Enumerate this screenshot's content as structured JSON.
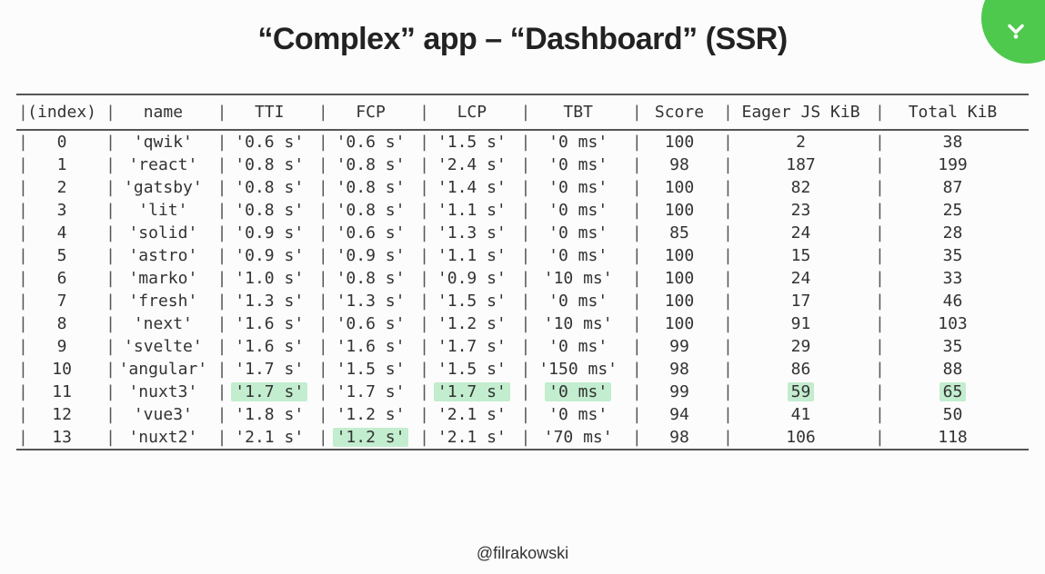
{
  "title": "“Complex” app – “Dashboard” (SSR)",
  "footer": "@filrakowski",
  "badge_icon": "chevron-down-icon",
  "columns": [
    "(index)",
    "name",
    "TTI",
    "FCP",
    "LCP",
    "TBT",
    "Score",
    "Eager JS KiB",
    "Total KiB"
  ],
  "highlight_color": "#c3edcf",
  "rows": [
    {
      "index": "0",
      "name": "'qwik'",
      "tti": "'0.6 s'",
      "fcp": "'0.6 s'",
      "lcp": "'1.5 s'",
      "tbt": "'0 ms'",
      "score": "100",
      "eager": "2",
      "total": "38"
    },
    {
      "index": "1",
      "name": "'react'",
      "tti": "'0.8 s'",
      "fcp": "'0.8 s'",
      "lcp": "'2.4 s'",
      "tbt": "'0 ms'",
      "score": "98",
      "eager": "187",
      "total": "199"
    },
    {
      "index": "2",
      "name": "'gatsby'",
      "tti": "'0.8 s'",
      "fcp": "'0.8 s'",
      "lcp": "'1.4 s'",
      "tbt": "'0 ms'",
      "score": "100",
      "eager": "82",
      "total": "87"
    },
    {
      "index": "3",
      "name": "'lit'",
      "tti": "'0.8 s'",
      "fcp": "'0.8 s'",
      "lcp": "'1.1 s'",
      "tbt": "'0 ms'",
      "score": "100",
      "eager": "23",
      "total": "25"
    },
    {
      "index": "4",
      "name": "'solid'",
      "tti": "'0.9 s'",
      "fcp": "'0.6 s'",
      "lcp": "'1.3 s'",
      "tbt": "'0 ms'",
      "score": "85",
      "eager": "24",
      "total": "28"
    },
    {
      "index": "5",
      "name": "'astro'",
      "tti": "'0.9 s'",
      "fcp": "'0.9 s'",
      "lcp": "'1.1 s'",
      "tbt": "'0 ms'",
      "score": "100",
      "eager": "15",
      "total": "35"
    },
    {
      "index": "6",
      "name": "'marko'",
      "tti": "'1.0 s'",
      "fcp": "'0.8 s'",
      "lcp": "'0.9 s'",
      "tbt": "'10 ms'",
      "score": "100",
      "eager": "24",
      "total": "33"
    },
    {
      "index": "7",
      "name": "'fresh'",
      "tti": "'1.3 s'",
      "fcp": "'1.3 s'",
      "lcp": "'1.5 s'",
      "tbt": "'0 ms'",
      "score": "100",
      "eager": "17",
      "total": "46"
    },
    {
      "index": "8",
      "name": "'next'",
      "tti": "'1.6 s'",
      "fcp": "'0.6 s'",
      "lcp": "'1.2 s'",
      "tbt": "'10 ms'",
      "score": "100",
      "eager": "91",
      "total": "103"
    },
    {
      "index": "9",
      "name": "'svelte'",
      "tti": "'1.6 s'",
      "fcp": "'1.6 s'",
      "lcp": "'1.7 s'",
      "tbt": "'0 ms'",
      "score": "99",
      "eager": "29",
      "total": "35"
    },
    {
      "index": "10",
      "name": "'angular'",
      "tti": "'1.7 s'",
      "fcp": "'1.5 s'",
      "lcp": "'1.5 s'",
      "tbt": "'150 ms'",
      "score": "98",
      "eager": "86",
      "total": "88"
    },
    {
      "index": "11",
      "name": "'nuxt3'",
      "tti": "'1.7 s'",
      "fcp": "'1.7 s'",
      "lcp": "'1.7 s'",
      "tbt": "'0 ms'",
      "score": "99",
      "eager": "59",
      "total": "65",
      "highlight": [
        "tti",
        "lcp",
        "tbt",
        "eager",
        "total"
      ]
    },
    {
      "index": "12",
      "name": "'vue3'",
      "tti": "'1.8 s'",
      "fcp": "'1.2 s'",
      "lcp": "'2.1 s'",
      "tbt": "'0 ms'",
      "score": "94",
      "eager": "41",
      "total": "50"
    },
    {
      "index": "13",
      "name": "'nuxt2'",
      "tti": "'2.1 s'",
      "fcp": "'1.2 s'",
      "lcp": "'2.1 s'",
      "tbt": "'70 ms'",
      "score": "98",
      "eager": "106",
      "total": "118",
      "highlight": [
        "fcp"
      ]
    }
  ],
  "chart_data": {
    "type": "table",
    "title": "“Complex” app – “Dashboard” (SSR)",
    "columns": [
      "index",
      "name",
      "TTI_s",
      "FCP_s",
      "LCP_s",
      "TBT_ms",
      "Score",
      "Eager_JS_KiB",
      "Total_KiB"
    ],
    "data": [
      [
        0,
        "qwik",
        0.6,
        0.6,
        1.5,
        0,
        100,
        2,
        38
      ],
      [
        1,
        "react",
        0.8,
        0.8,
        2.4,
        0,
        98,
        187,
        199
      ],
      [
        2,
        "gatsby",
        0.8,
        0.8,
        1.4,
        0,
        100,
        82,
        87
      ],
      [
        3,
        "lit",
        0.8,
        0.8,
        1.1,
        0,
        100,
        23,
        25
      ],
      [
        4,
        "solid",
        0.9,
        0.6,
        1.3,
        0,
        85,
        24,
        28
      ],
      [
        5,
        "astro",
        0.9,
        0.9,
        1.1,
        0,
        100,
        15,
        35
      ],
      [
        6,
        "marko",
        1.0,
        0.8,
        0.9,
        10,
        100,
        24,
        33
      ],
      [
        7,
        "fresh",
        1.3,
        1.3,
        1.5,
        0,
        100,
        17,
        46
      ],
      [
        8,
        "next",
        1.6,
        0.6,
        1.2,
        10,
        100,
        91,
        103
      ],
      [
        9,
        "svelte",
        1.6,
        1.6,
        1.7,
        0,
        99,
        29,
        35
      ],
      [
        10,
        "angular",
        1.7,
        1.5,
        1.5,
        150,
        98,
        86,
        88
      ],
      [
        11,
        "nuxt3",
        1.7,
        1.7,
        1.7,
        0,
        99,
        59,
        65
      ],
      [
        12,
        "vue3",
        1.8,
        1.2,
        2.1,
        0,
        94,
        41,
        50
      ],
      [
        13,
        "nuxt2",
        2.1,
        1.2,
        2.1,
        70,
        98,
        106,
        118
      ]
    ]
  }
}
